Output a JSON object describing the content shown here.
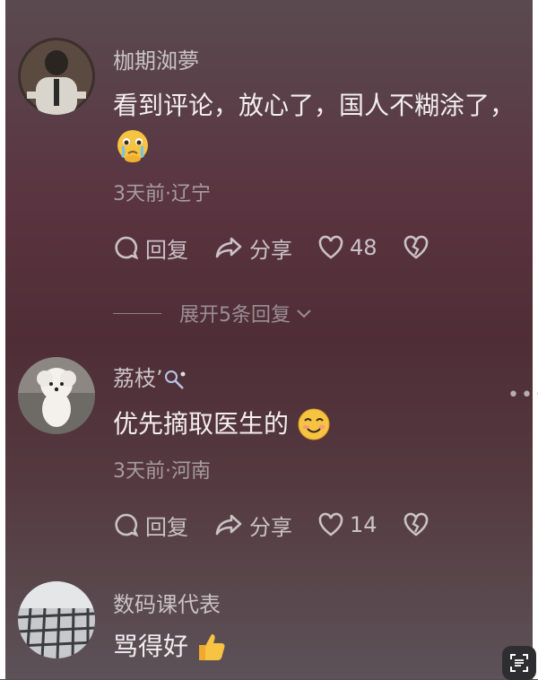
{
  "comments": [
    {
      "username": "枷期洳夢",
      "text_line1": "看到评论，放心了，国人不糊涂了，",
      "emoji": "crying-emoji",
      "meta": "3天前·辽宁",
      "reply_label": "回复",
      "share_label": "分享",
      "like_count": "48"
    },
    {
      "username": "荔枝’",
      "text": "优先摘取医生的",
      "emoji": "smiling-emoji",
      "meta": "3天前·河南",
      "reply_label": "回复",
      "share_label": "分享",
      "like_count": "14"
    },
    {
      "username": "数码课代表",
      "text": "骂得好",
      "emoji": "thumbs-up-emoji"
    }
  ],
  "expand_replies": "展开5条回复",
  "colors": {
    "accent_yellow": "#f6c343",
    "text": "#f2eef0",
    "muted": "#a69ca1"
  }
}
